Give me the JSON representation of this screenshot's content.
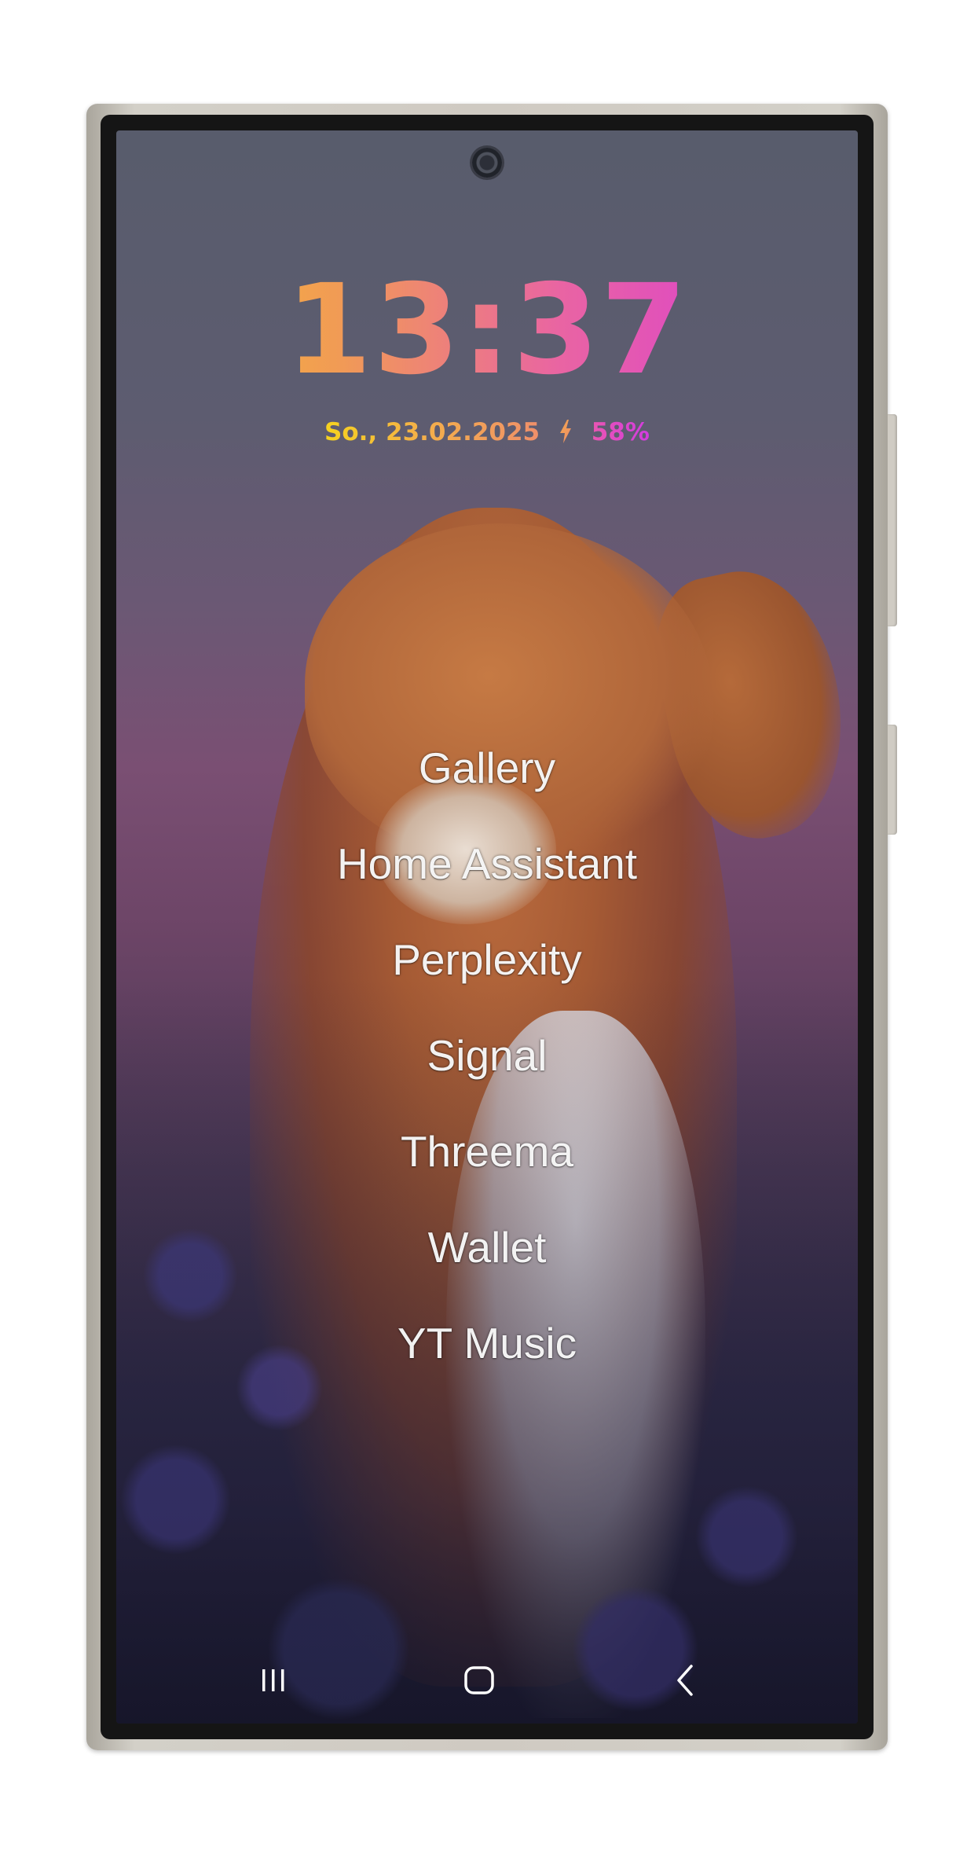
{
  "lockscreen": {
    "time": "13:37",
    "date": "So., 23.02.2025",
    "battery": "58%",
    "charging_icon": "lightning-bolt-icon"
  },
  "app_list": [
    {
      "label": "Gallery"
    },
    {
      "label": "Home Assistant"
    },
    {
      "label": "Perplexity"
    },
    {
      "label": "Signal"
    },
    {
      "label": "Threema"
    },
    {
      "label": "Wallet"
    },
    {
      "label": "YT Music"
    }
  ],
  "navbar": {
    "recents_icon": "recents-icon",
    "home_icon": "home-icon",
    "back_icon": "back-icon"
  },
  "colors": {
    "clock_gradient_start": "#f7c22b",
    "clock_gradient_end": "#d431e1",
    "app_label": "#ffffff",
    "device_frame": "#cfcac2"
  }
}
